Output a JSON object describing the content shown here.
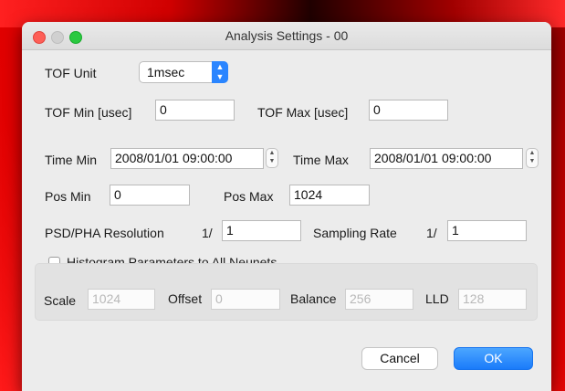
{
  "window": {
    "title": "Analysis Settings - 00"
  },
  "tof": {
    "unit_label": "TOF Unit",
    "unit_value": "1msec",
    "min_label": "TOF Min [usec]",
    "min_value": "0",
    "max_label": "TOF Max [usec]",
    "max_value": "0"
  },
  "time": {
    "min_label": "Time Min",
    "min_value": "2008/01/01 09:00:00",
    "max_label": "Time Max",
    "max_value": "2008/01/01 09:00:00"
  },
  "pos": {
    "min_label": "Pos Min",
    "min_value": "0",
    "max_label": "Pos Max",
    "max_value": "1024"
  },
  "resolution": {
    "psd_label": "PSD/PHA Resolution",
    "psd_prefix": "1/",
    "psd_value": "1",
    "sampling_label": "Sampling Rate",
    "sampling_prefix": "1/",
    "sampling_value": "1"
  },
  "histogram": {
    "checkbox_label": "Histogram Parameters to All Neunets",
    "checked": false,
    "scale_label": "Scale",
    "scale_value": "1024",
    "offset_label": "Offset",
    "offset_value": "0",
    "balance_label": "Balance",
    "balance_value": "256",
    "lld_label": "LLD",
    "lld_value": "128"
  },
  "buttons": {
    "cancel": "Cancel",
    "ok": "OK"
  },
  "icons": {
    "select_arrows": "up-down-chevron-icon",
    "stepper": "stepper-icon"
  },
  "colors": {
    "accent": "#1a7bfa",
    "close": "#fe5f57",
    "zoom": "#2ac940"
  }
}
